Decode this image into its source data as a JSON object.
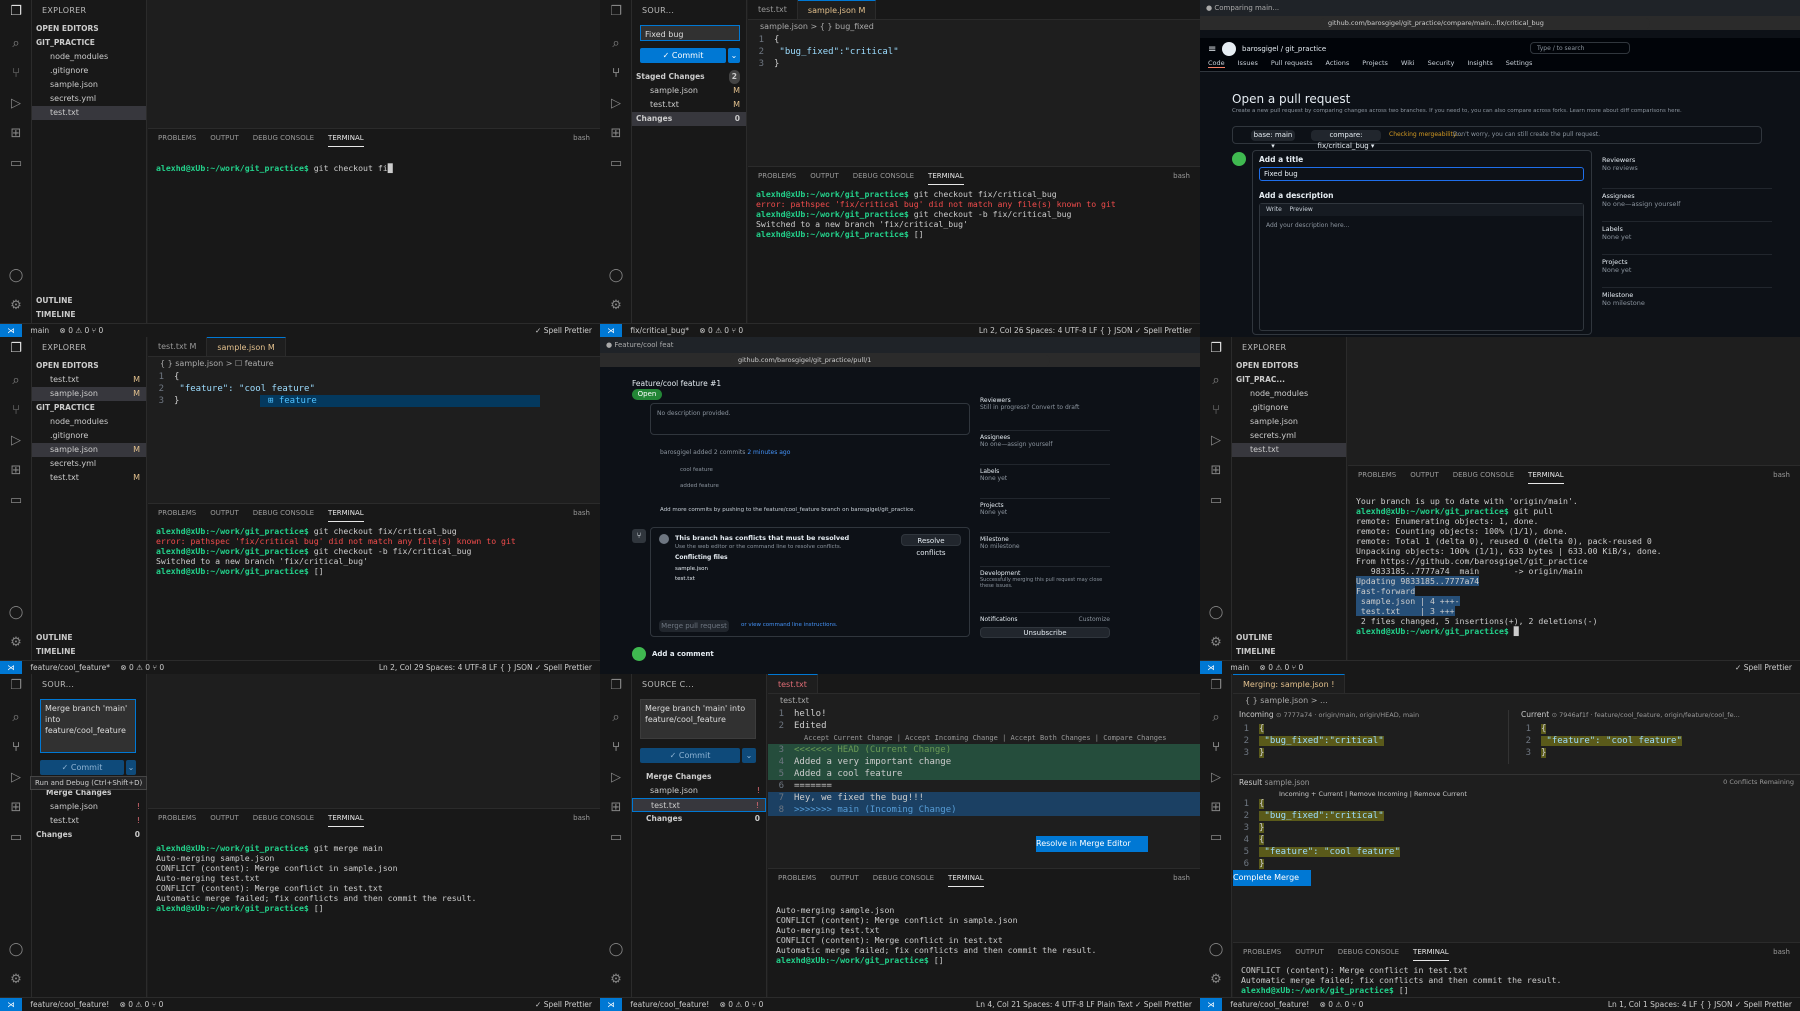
{
  "cell1": {
    "explorer_title": "EXPLORER",
    "open_editors": "OPEN EDITORS",
    "repo": "GIT_PRACTICE",
    "files": [
      "node_modules",
      ".gitignore",
      "sample.json",
      "secrets.yml",
      "test.txt"
    ],
    "panel_tabs": [
      "PROBLEMS",
      "OUTPUT",
      "DEBUG CONSOLE",
      "TERMINAL"
    ],
    "shell": "bash",
    "prompt": "alexhd@xUb:~/work/git_practice$",
    "cmd": " git checkout fi",
    "outline": "OUTLINE",
    "timeline": "TIMELINE",
    "status_branch": "main",
    "status_counts": "⊗ 0 ⚠ 0  ⑂ 0",
    "status_right": "✓ Spell  Prettier"
  },
  "cell2": {
    "scm_title": "SOUR...",
    "commit_msg": "Fixed bug",
    "commit_label": "✓ Commit",
    "staged": "Staged Changes",
    "staged_count": "2",
    "files": [
      "sample.json",
      "test.txt"
    ],
    "file_mark": "M",
    "changes": "Changes",
    "changes_count": "0",
    "tabs": [
      "test.txt",
      "sample.json M"
    ],
    "crumb": "sample.json > { } bug_fixed",
    "code_lines": [
      "{",
      "    \"bug_fixed\":\"critical\"",
      "}"
    ],
    "panel_tabs": [
      "PROBLEMS",
      "OUTPUT",
      "DEBUG CONSOLE",
      "TERMINAL"
    ],
    "shell": "bash",
    "t1_prompt": "alexhd@xUb:~/work/git_practice$",
    "t1_cmd": " git checkout fix/critical_bug",
    "t2": "error: pathspec 'fix/critical bug' did not match any file(s) known to git",
    "t3_cmd": " git checkout -b fix/critical_bug",
    "t4": "Switched to a new branch 'fix/critical_bug'",
    "status_branch": "fix/critical_bug*",
    "status_counts": "⊗ 0 ⚠ 0  ⑂ 0",
    "status_right": "Ln 2, Col 26   Spaces: 4   UTF-8   LF   { } JSON   ✓ Spell   Prettier"
  },
  "cell3": {
    "url": "github.com/barosgigel/git_practice/compare/main...fix/critical_bug",
    "repo": "barosgigel / git_practice",
    "nav": [
      "Code",
      "Issues",
      "Pull requests",
      "Actions",
      "Projects",
      "Wiki",
      "Security",
      "Insights",
      "Settings"
    ],
    "search": "Type / to search",
    "title": "Open a pull request",
    "subtitle": "Create a new pull request by comparing changes across two branches. If you need to, you can also compare across forks. Learn more about diff comparisons here.",
    "base": "base: main ▾",
    "compare": "compare: fix/critical_bug ▾",
    "checking": "Checking mergeability…",
    "checking_note": "Don't worry, you can still create the pull request.",
    "add_title": "Add a title",
    "title_value": "Fixed bug",
    "add_desc": "Add a description",
    "write": "Write",
    "preview": "Preview",
    "desc_placeholder": "Add your description here...",
    "side": [
      [
        "Reviewers",
        "No reviews"
      ],
      [
        "Assignees",
        "No one—assign yourself"
      ],
      [
        "Labels",
        "None yet"
      ],
      [
        "Projects",
        "None yet"
      ],
      [
        "Milestone",
        "No milestone"
      ]
    ]
  },
  "cell4": {
    "explorer_title": "EXPLORER",
    "open_editors": "OPEN EDITORS",
    "repo": "GIT_PRACTICE",
    "open_files": [
      "test.txt",
      "sample.json"
    ],
    "files": [
      "node_modules",
      ".gitignore",
      "sample.json",
      "secrets.yml",
      "test.txt"
    ],
    "tabs": [
      "test.txt M",
      "sample.json M"
    ],
    "crumb": "{ } sample.json > ☐ feature",
    "code_lines": [
      "{",
      "    \"feature\": \"cool feature\"",
      "}"
    ],
    "suggest": "feature",
    "panel_tabs": [
      "PROBLEMS",
      "OUTPUT",
      "DEBUG CONSOLE",
      "TERMINAL"
    ],
    "shell": "bash",
    "prompt": "alexhd@xUb:~/work/git_practice$",
    "c1": " git checkout fix/critical_bug",
    "e1": "error: pathspec 'fix/critical bug' did not match any file(s) known to git",
    "c2": " git checkout -b fix/critical_bug",
    "o1": "Switched to a new branch 'fix/critical_bug'",
    "outline": "OUTLINE",
    "timeline": "TIMELINE",
    "status_branch": "feature/cool_feature*",
    "status_counts": "⊗ 0 ⚠ 0  ⑂ 0",
    "status_right": "Ln 2, Col 29   Spaces: 4   UTF-8   LF   { } JSON   ✓ Spell   Prettier"
  },
  "cell5": {
    "url": "github.com/barosgigel/git_practice/pull/1",
    "pr_title": "Feature/cool feature #1",
    "open": "Open",
    "no_desc": "No description provided.",
    "commit_note": "barosgigel added 2 commits",
    "commit_time": "2 minutes ago",
    "commits": [
      "cool feature",
      "added feature"
    ],
    "push_note": "Add more commits by pushing to the feature/cool_feature branch on barosgigel/git_practice.",
    "conflict_title": "This branch has conflicts that must be resolved",
    "conflict_note": "Use the web editor or the command line to resolve conflicts.",
    "conflict_files": "Conflicting files",
    "cf": [
      "sample.json",
      "test.txt"
    ],
    "resolve": "Resolve conflicts",
    "merge": "Merge pull request",
    "or_view": "or view command line instructions.",
    "add_comment": "Add a comment",
    "side": [
      [
        "Reviewers",
        "Still in progress? Convert to draft"
      ],
      [
        "Assignees",
        "No one—assign yourself"
      ],
      [
        "Labels",
        "None yet"
      ],
      [
        "Projects",
        "None yet"
      ],
      [
        "Milestone",
        "No milestone"
      ],
      [
        "Development",
        "Successfully merging this pull request may close these issues."
      ],
      [
        "Notifications",
        "Customize"
      ]
    ],
    "subscribe": "Unsubscribe"
  },
  "cell6": {
    "explorer_title": "EXPLORER",
    "open_editors": "OPEN EDITORS",
    "repo": "GIT_PRAC...",
    "files": [
      "node_modules",
      ".gitignore",
      "sample.json",
      "secrets.yml",
      "test.txt"
    ],
    "panel_tabs": [
      "PROBLEMS",
      "OUTPUT",
      "DEBUG CONSOLE",
      "TERMINAL"
    ],
    "shell": "bash",
    "l0": "Your branch is up to date with 'origin/main'.",
    "prompt": "alexhd@xUb:~/work/git_practice$",
    "c1": " git pull",
    "lines": [
      "remote: Enumerating objects: 1, done.",
      "remote: Counting objects: 100% (1/1), done.",
      "remote: Total 1 (delta 0), reused 0 (delta 0), pack-reused 0",
      "Unpacking objects: 100% (1/1), 633 bytes | 633.00 KiB/s, done.",
      "From https://github.com/barosgigel/git_practice",
      "   9833185..7777a74  main       -> origin/main",
      "Updating 9833185..7777a74",
      "Fast-forward",
      " sample.json | 4 +++-",
      " test.txt    | 3 +++",
      " 2 files changed, 5 insertions(+), 2 deletions(-)"
    ],
    "outline": "OUTLINE",
    "timeline": "TIMELINE",
    "status_branch": "main",
    "status_counts": "⊗ 0 ⚠ 0  ⑂ 0",
    "status_right": "✓ Spell  Prettier"
  },
  "cell7": {
    "scm_title": "SOUR...",
    "commit_msg": "Merge branch 'main' into feature/cool_feature",
    "commit_label": "✓ Commit",
    "tooltip": "Run and Debug (Ctrl+Shift+D)",
    "merge_changes": "Merge Changes",
    "files": [
      "sample.json",
      "test.txt"
    ],
    "changes": "Changes",
    "count": "0",
    "panel_tabs": [
      "PROBLEMS",
      "OUTPUT",
      "DEBUG CONSOLE",
      "TERMINAL"
    ],
    "shell": "bash",
    "prompt": "alexhd@xUb:~/work/git_practice$",
    "c1": " git merge main",
    "lines": [
      "Auto-merging sample.json",
      "CONFLICT (content): Merge conflict in sample.json",
      "Auto-merging test.txt",
      "CONFLICT (content): Merge conflict in test.txt",
      "Automatic merge failed; fix conflicts and then commit the result."
    ],
    "status_branch": "feature/cool_feature!",
    "status_counts": "⊗ 0 ⚠ 0  ⑂ 0",
    "status_right": "✓ Spell  Prettier"
  },
  "cell8": {
    "scm_title": "SOURCE C...",
    "commit_msg": "Merge branch 'main' into feature/cool_feature",
    "commit_label": "✓ Commit",
    "merge_changes": "Merge Changes",
    "files": [
      "sample.json",
      "test.txt"
    ],
    "changes": "Changes",
    "count": "0",
    "tabs": [
      "test.txt"
    ],
    "crumb": "test.txt",
    "l1": "hello!",
    "l2": "Edited",
    "codelens": "Accept Current Change | Accept Incoming Change | Accept Both Changes | Compare Changes",
    "l3": "<<<<<<< HEAD (Current Change)",
    "l4": "Added a very important change",
    "l5": "Added a cool feature",
    "l6": "=======",
    "l7": "Hey, we fixed the bug!!!",
    "l8": ">>>>>>> main (Incoming Change)",
    "resolve_btn": "Resolve in Merge Editor",
    "panel_tabs": [
      "PROBLEMS",
      "OUTPUT",
      "DEBUG CONSOLE",
      "TERMINAL"
    ],
    "shell": "bash",
    "lines": [
      "Auto-merging sample.json",
      "CONFLICT (content): Merge conflict in sample.json",
      "Auto-merging test.txt",
      "CONFLICT (content): Merge conflict in test.txt",
      "Automatic merge failed; fix conflicts and then commit the result."
    ],
    "prompt": "alexhd@xUb:~/work/git_practice$",
    "status_branch": "feature/cool_feature!",
    "status_counts": "⊗ 0 ⚠ 0  ⑂ 0",
    "status_right": "Ln 4, Col 21   Spaces: 4   UTF-8   LF   Plain Text   ✓ Spell   Prettier"
  },
  "cell9": {
    "tab": "Merging: sample.json !",
    "crumb": "{ } sample.json > ...",
    "incoming": "Incoming",
    "incoming_ref": "⊙ 7777a74 · origin/main, origin/HEAD, main",
    "current": "Current",
    "current_ref": "⊙ 7946af1f · feature/cool_feature, origin/feature/cool_fe...",
    "inc_lines": [
      "{",
      "    \"bug_fixed\":\"critical\"",
      "}"
    ],
    "cur_lines": [
      "{",
      "    \"feature\": \"cool feature\"",
      "}"
    ],
    "result": "Result",
    "result_file": "sample.json",
    "remaining": "0 Conflicts Remaining",
    "result_lens": "Incoming + Current | Remove Incoming | Remove Current",
    "res_lines": [
      "{",
      "    \"bug_fixed\":\"critical\"",
      "}",
      "{",
      "    \"feature\": \"cool feature\"",
      "}"
    ],
    "complete": "Complete Merge",
    "panel_tabs": [
      "PROBLEMS",
      "OUTPUT",
      "DEBUG CONSOLE",
      "TERMINAL"
    ],
    "shell": "bash",
    "lines": [
      "CONFLICT (content): Merge conflict in test.txt",
      "Automatic merge failed; fix conflicts and then commit the result."
    ],
    "prompt": "alexhd@xUb:~/work/git_practice$",
    "status_branch": "feature/cool_feature!",
    "status_counts": "⊗ 0 ⚠ 0  ⑂ 0",
    "status_right": "Ln 1, Col 1   Spaces: 4   LF   { } JSON   ✓ Spell   Prettier"
  },
  "colors": {
    "accent": "#0078d4",
    "prompt_green": "#23d18b",
    "path_blue": "#3b8eea",
    "error_red": "#f14c4c",
    "github_bg": "#0d1117"
  }
}
